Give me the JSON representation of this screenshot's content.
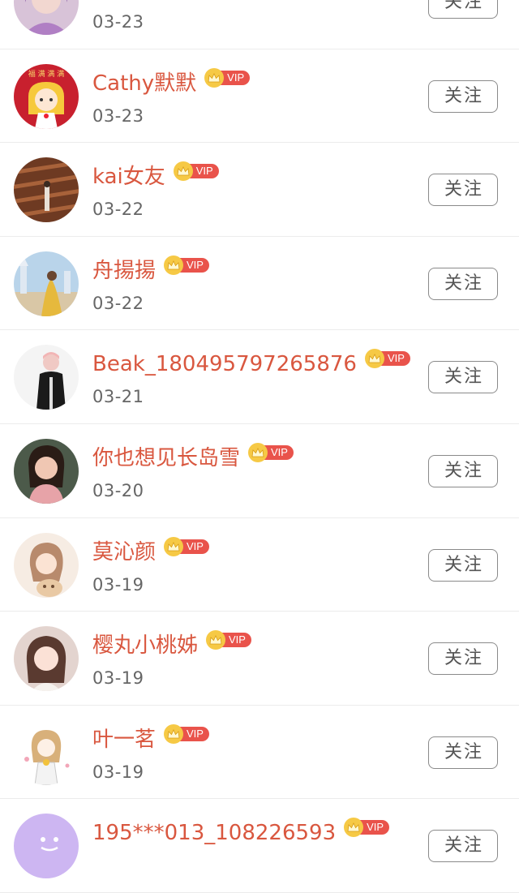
{
  "follow_label": "关注",
  "vip_label": "VIP",
  "colors": {
    "name": "#d9573f",
    "vip_badge": "#e9534b",
    "crown": "#f6c945",
    "date": "#666666",
    "button_border": "#8a8a8a"
  },
  "users": [
    {
      "name": "",
      "date": "03-23",
      "vip": false,
      "avatar": "purple-girl"
    },
    {
      "name": "Cathy默默",
      "date": "03-23",
      "vip": true,
      "avatar": "red-cartoon"
    },
    {
      "name": "kai女友",
      "date": "03-22",
      "vip": true,
      "avatar": "brown-wood"
    },
    {
      "name": "舟揚揚",
      "date": "03-22",
      "vip": true,
      "avatar": "castle-yellow-dress"
    },
    {
      "name": "Beak_180495797265876",
      "date": "03-21",
      "vip": true,
      "avatar": "black-jacket-person"
    },
    {
      "name": "你也想见长岛雪",
      "date": "03-20",
      "vip": true,
      "avatar": "girl-portrait"
    },
    {
      "name": "莫沁颜",
      "date": "03-19",
      "vip": true,
      "avatar": "painted-girl-cat"
    },
    {
      "name": "樱丸小桃姊",
      "date": "03-19",
      "vip": true,
      "avatar": "soft-girl-photo"
    },
    {
      "name": "叶一茗",
      "date": "03-19",
      "vip": true,
      "avatar": "sketch-girl"
    },
    {
      "name": "195***013_108226593",
      "date": "",
      "vip": true,
      "avatar": "purple-default"
    }
  ]
}
